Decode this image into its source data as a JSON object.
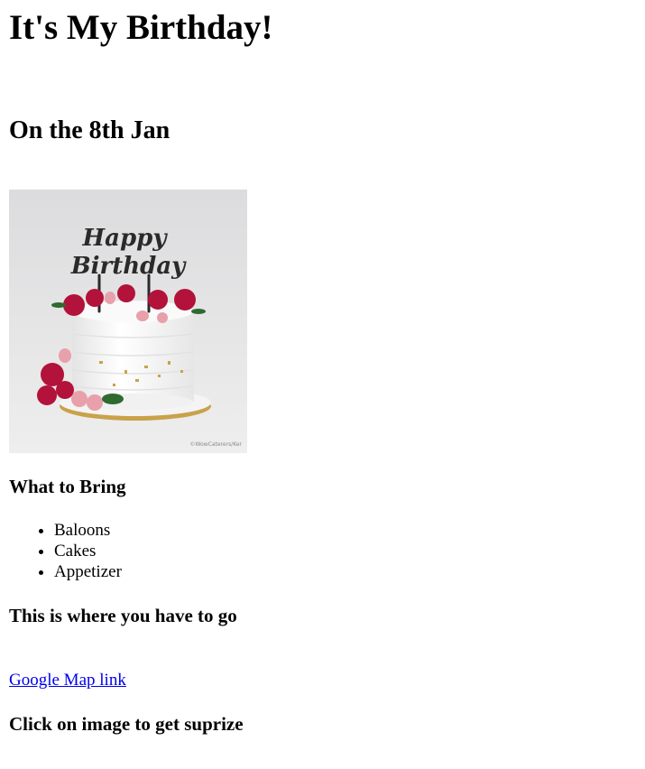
{
  "page": {
    "title": "It's My Birthday!",
    "subtitle": "On the 8th Jan"
  },
  "image": {
    "topper_line1": "Happy",
    "topper_line2": "Birthday",
    "watermark": "©WowCaterers/Ker"
  },
  "bring": {
    "heading": "What to Bring",
    "items": [
      "Baloons",
      "Cakes",
      "Appetizer"
    ]
  },
  "location": {
    "heading": "This is where you have to go",
    "link_label": "Google Map link"
  },
  "surprise": {
    "heading": "Click on image to get suprize"
  },
  "colors": {
    "link": "#0000ee",
    "rose": "#b3123a",
    "macaron": "#e8a0aa",
    "gold": "#c9a24a"
  }
}
